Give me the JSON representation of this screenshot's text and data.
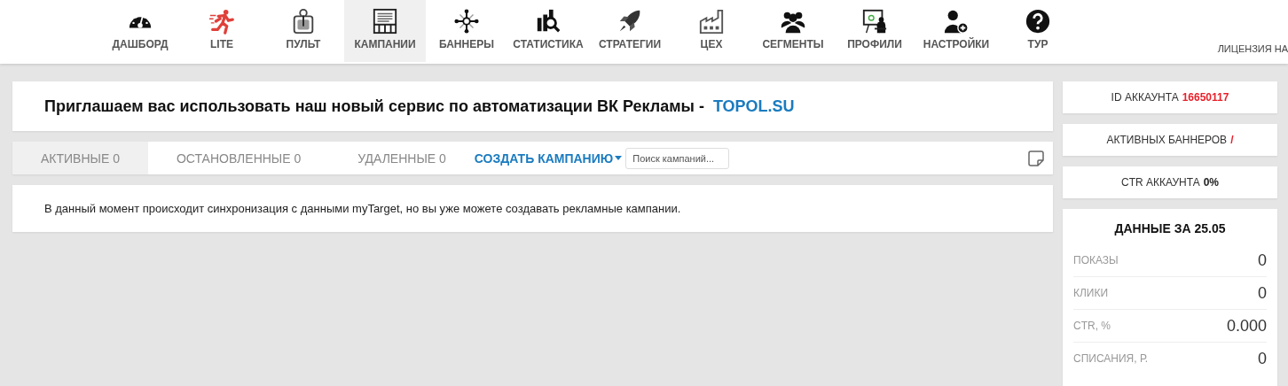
{
  "nav": {
    "items": [
      {
        "label": "ДАШБОРД",
        "selected": false
      },
      {
        "label": "LITE",
        "selected": false
      },
      {
        "label": "ПУЛЬТ",
        "selected": false
      },
      {
        "label": "КАМПАНИИ",
        "selected": true
      },
      {
        "label": "БАННЕРЫ",
        "selected": false
      },
      {
        "label": "СТАТИСТИКА",
        "selected": false
      },
      {
        "label": "СТРАТЕГИИ",
        "selected": false
      },
      {
        "label": "ЦЕХ",
        "selected": false
      },
      {
        "label": "СЕГМЕНТЫ",
        "selected": false
      },
      {
        "label": "ПРОФИЛИ",
        "selected": false
      },
      {
        "label": "НАСТРОЙКИ",
        "selected": false
      },
      {
        "label": "ТУР",
        "selected": false
      }
    ],
    "license": "ЛИЦЕНЗИЯ НА"
  },
  "announcement": {
    "text": "Приглашаем вас использовать наш новый сервис по автоматизации ВК Рекламы - ",
    "link": "TOPOL.SU"
  },
  "tabs": [
    {
      "label": "АКТИВНЫЕ 0",
      "selected": true
    },
    {
      "label": "ОСТАНОВЛЕННЫЕ 0",
      "selected": false
    },
    {
      "label": "УДАЛЕННЫЕ 0",
      "selected": false
    }
  ],
  "create_button": "СОЗДАТЬ КАМПАНИЮ",
  "search": {
    "placeholder": "Поиск кампаний..."
  },
  "message": "В данный момент происходит синхронизация с данными myTarget, но вы уже можете создавать рекламные кампании.",
  "account": [
    {
      "label": "ID АККАУНТА",
      "value": "16650117",
      "color": "#e8202a"
    },
    {
      "label": "АКТИВНЫХ БАННЕРОВ",
      "value": "/",
      "color": "#e8202a"
    },
    {
      "label": "CTR АККАУНТА",
      "value": "0%",
      "color": "#222222"
    }
  ],
  "daily": {
    "title": "ДАННЫЕ ЗА 25.05",
    "rows": [
      {
        "label": "ПОКАЗЫ",
        "value": "0"
      },
      {
        "label": "КЛИКИ",
        "value": "0"
      },
      {
        "label": "CTR, %",
        "value": "0.000"
      },
      {
        "label": "СПИСАНИЯ, Р.",
        "value": "0"
      }
    ]
  }
}
